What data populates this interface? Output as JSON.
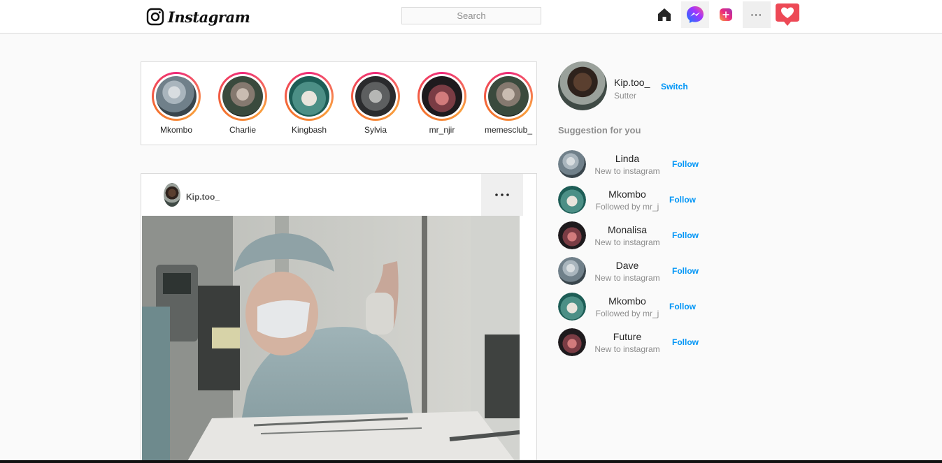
{
  "topbar": {
    "logo_text": "Instagram",
    "search_placeholder": "Search",
    "icons": [
      "home-icon",
      "messenger-icon",
      "add-post-icon",
      "more-icon",
      "heart-icon"
    ]
  },
  "stories": [
    {
      "username": "Mkombo"
    },
    {
      "username": "Charlie"
    },
    {
      "username": "Kingbash"
    },
    {
      "username": "Sylvia"
    },
    {
      "username": "mr_njir"
    },
    {
      "username": "memesclub_"
    }
  ],
  "post": {
    "username": "Kip.too_"
  },
  "sidebar": {
    "username": "Kip.too_",
    "fullname": "Sutter",
    "switch_label": "Switch",
    "suggestions_title": "Suggestion for you",
    "suggestions": [
      {
        "name": "Linda",
        "subtitle": "New to instagram",
        "action": "Follow"
      },
      {
        "name": "Mkombo",
        "subtitle": "Followed by mr_j",
        "action": "Follow"
      },
      {
        "name": "Monalisa",
        "subtitle": "New to instagram",
        "action": "Follow"
      },
      {
        "name": "Dave",
        "subtitle": "New to instagram",
        "action": "Follow"
      },
      {
        "name": "Mkombo",
        "subtitle": "Followed by mr_j",
        "action": "Follow"
      },
      {
        "name": "Future",
        "subtitle": "New to instagram",
        "action": "Follow"
      }
    ]
  },
  "colors": {
    "link_blue": "#0095f6",
    "story_ring_start": "#ee2a7b",
    "story_ring_end": "#f9a03f",
    "heart_red": "#ed4956"
  }
}
